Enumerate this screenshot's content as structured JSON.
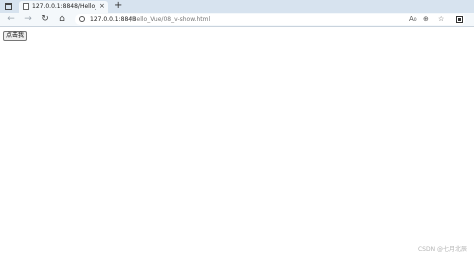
{
  "tab": {
    "title": "127.0.0.1:8848/Hello_Vue/08_v-show.html",
    "close_label": "×"
  },
  "new_tab_label": "+",
  "nav": {
    "back_glyph": "←",
    "forward_glyph": "→",
    "reload_glyph": "↻",
    "home_glyph": "⌂"
  },
  "address": {
    "host": "127.0.0.1:8848",
    "path": "/Hello_Vue/08_v-show.html"
  },
  "address_icons": {
    "read_aloud": "A₀",
    "zoom": "⊕",
    "favorites": "☆"
  },
  "page": {
    "button_label": "点击我"
  },
  "watermark": "CSDN @七月北辰"
}
